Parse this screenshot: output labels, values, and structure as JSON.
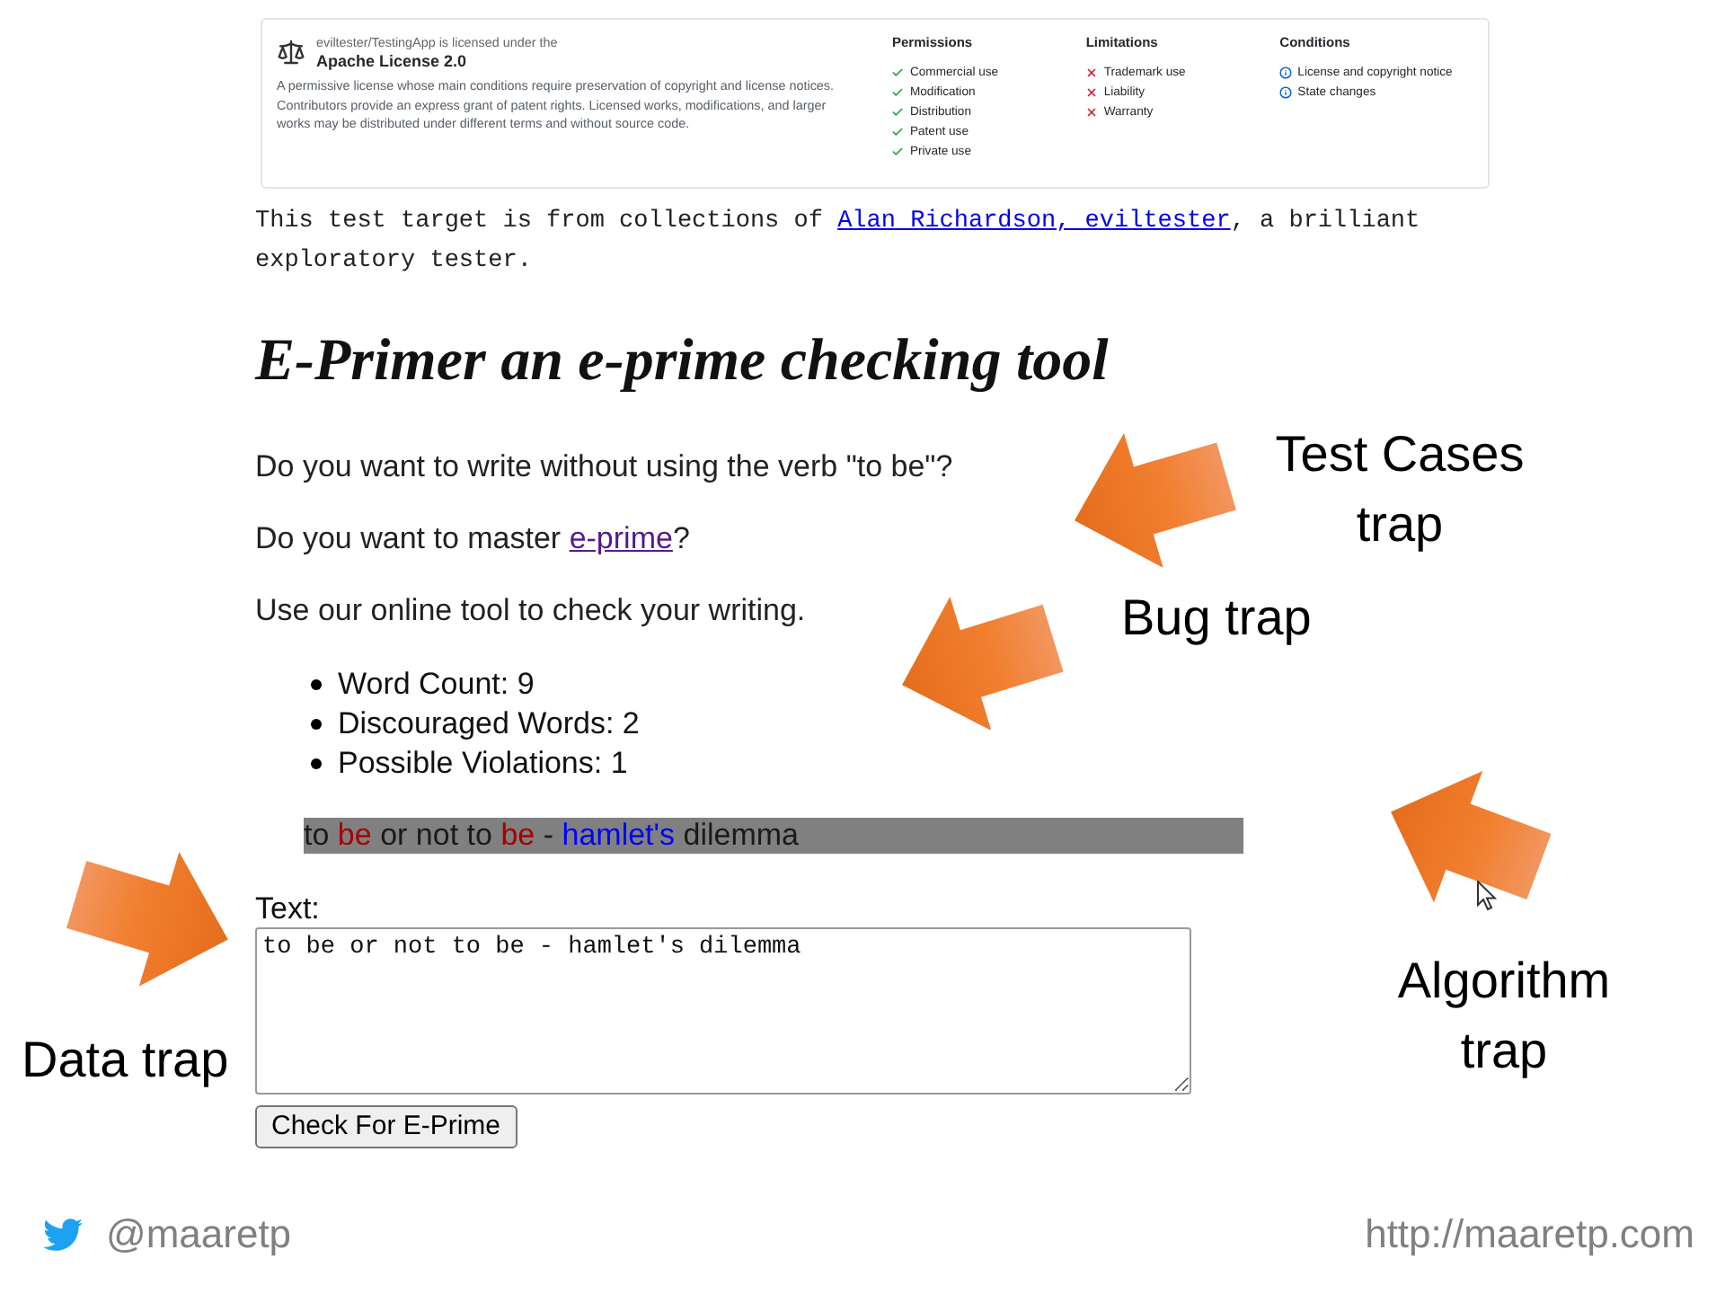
{
  "license_card": {
    "repo_line": "eviltester/TestingApp is licensed under the",
    "license": "Apache License 2.0",
    "description": "A permissive license whose main conditions require preservation of copyright and license notices. Contributors provide an express grant of patent rights. Licensed works, modifications, and larger works may be distributed under different terms and without source code.",
    "columns": [
      {
        "title": "Permissions",
        "kind": "permission",
        "items": [
          "Commercial use",
          "Modification",
          "Distribution",
          "Patent use",
          "Private use"
        ]
      },
      {
        "title": "Limitations",
        "kind": "limitation",
        "items": [
          "Trademark use",
          "Liability",
          "Warranty"
        ]
      },
      {
        "title": "Conditions",
        "kind": "condition",
        "items": [
          "License and copyright notice",
          "State changes"
        ]
      }
    ]
  },
  "intro": {
    "before": "This test target is from collections of ",
    "link": {
      "text": "Alan Richardson, eviltester",
      "visited": false
    },
    "after": ", a brilliant exploratory tester."
  },
  "heading": "E-Primer an e-prime checking tool",
  "paragraphs": [
    {
      "kind": "text",
      "text": "Do you want to write without using the verb \"to be\"?"
    },
    {
      "kind": "link",
      "before": "Do you want to master ",
      "link": {
        "text": "e-prime",
        "visited": true
      },
      "after": "?"
    },
    {
      "kind": "text",
      "text": "Use our online tool to check your writing."
    }
  ],
  "stats": [
    "Word Count: 9",
    "Discouraged Words: 2",
    "Possible Violations: 1"
  ],
  "highlight": {
    "segments": [
      {
        "text": "to",
        "kind": "plain"
      },
      {
        "text": "be",
        "kind": "discouraged"
      },
      {
        "text": "or not to",
        "kind": "plain"
      },
      {
        "text": "be",
        "kind": "discouraged"
      },
      {
        "text": "-",
        "kind": "plain"
      },
      {
        "text": "hamlet's",
        "kind": "violation"
      },
      {
        "text": "dilemma",
        "kind": "plain"
      }
    ]
  },
  "form": {
    "label": "Text:",
    "textarea": {
      "value": "to be or not to be - hamlet's dilemma"
    },
    "button": "Check For E-Prime"
  },
  "annotations": [
    {
      "lines": [
        "Test Cases",
        "trap"
      ]
    },
    {
      "lines": [
        "Bug trap"
      ]
    },
    {
      "lines": [
        "Data trap"
      ]
    },
    {
      "lines": [
        "Algorithm",
        "trap"
      ]
    }
  ],
  "footer": {
    "handle": "@maaretp",
    "url": "http://maaretp.com"
  }
}
